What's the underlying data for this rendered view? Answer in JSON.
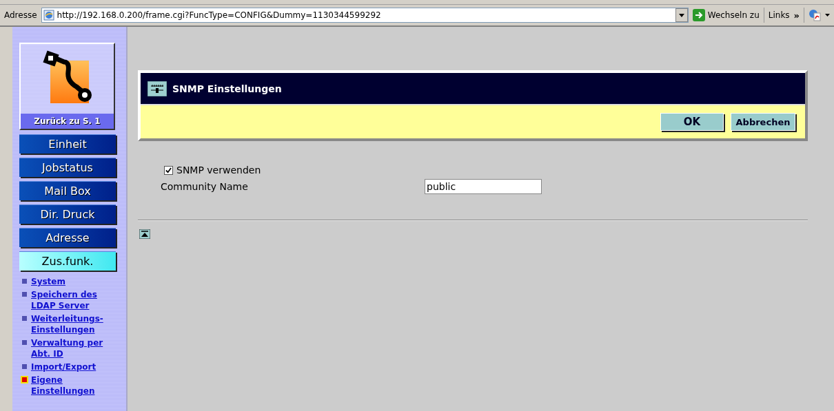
{
  "address_bar": {
    "label": "Adresse",
    "url": "http://192.168.0.200/frame.cgi?FuncType=CONFIG&Dummy=1130344599292",
    "go_button": "Wechseln zu",
    "links": "Links",
    "chevron": "»"
  },
  "sidebar": {
    "back_button": "Zurück zu S. 1",
    "nav_buttons": [
      {
        "label": "Einheit",
        "selected": false
      },
      {
        "label": "Jobstatus",
        "selected": false
      },
      {
        "label": "Mail Box",
        "selected": false
      },
      {
        "label": "Dir. Druck",
        "selected": false
      },
      {
        "label": "Adresse",
        "selected": false
      },
      {
        "label": "Zus.funk.",
        "selected": true
      }
    ],
    "links": [
      {
        "label": "System",
        "selected": false
      },
      {
        "label": "Speichern des LDAP Server",
        "selected": false
      },
      {
        "label": "Weiterleitungs-Einstellungen",
        "selected": false
      },
      {
        "label": "Verwaltung per Abt. ID",
        "selected": false
      },
      {
        "label": "Import/Export",
        "selected": false
      },
      {
        "label": "Eigene Einstellungen",
        "selected": true
      }
    ]
  },
  "panel": {
    "title": "SNMP Einstellungen",
    "buttons": [
      "OK",
      "Abbrechen"
    ]
  },
  "form": {
    "checkbox": {
      "label": "SNMP verwenden",
      "checked": true
    },
    "field": {
      "label": "Community Name",
      "value": "public"
    }
  }
}
